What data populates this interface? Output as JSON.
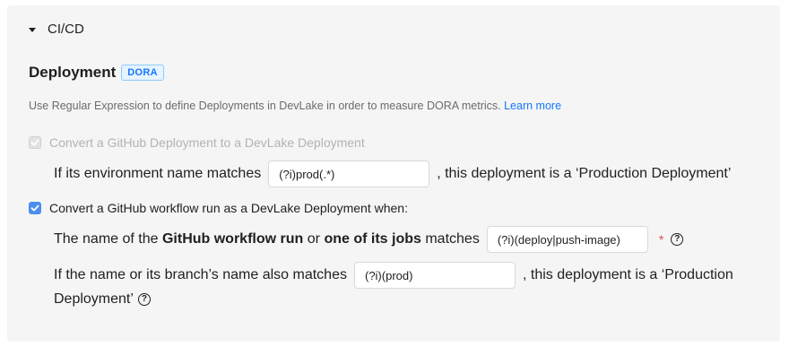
{
  "section": {
    "title": "CI/CD"
  },
  "deployment": {
    "title": "Deployment",
    "tag": "DORA",
    "description": "Use Regular Expression to define Deployments in DevLake in order to measure DORA metrics.",
    "learn_more": "Learn more"
  },
  "github_deployment": {
    "checkbox_label": "Convert a GitHub Deployment to a DevLake Deployment",
    "checked": true,
    "disabled": true,
    "env_prefix": "If its environment name matches",
    "env_value": "(?i)prod(.*)",
    "env_suffix": ", this deployment is a ‘Production Deployment’"
  },
  "workflow_run": {
    "checkbox_label": "Convert a GitHub workflow run as a DevLake Deployment when:",
    "checked": true,
    "name_prefix": "The name of the",
    "name_bold1": "GitHub workflow run",
    "name_or": "or",
    "name_bold2": "one of its jobs",
    "name_matches": "matches",
    "name_value": "(?i)(deploy|push-image)",
    "required_mark": "*",
    "branch_prefix": "If the name or its branch’s name also matches",
    "branch_value": "(?i)(prod)",
    "branch_suffix_1": ", this deployment is a ‘Production",
    "branch_suffix_2": "Deployment’"
  },
  "icons": {
    "help": "question-circle-icon",
    "caret": "caret-down-icon",
    "check": "check-icon"
  },
  "colors": {
    "accent": "#1677ff",
    "checkbox": "#4a8ef0",
    "required": "#e5484d"
  }
}
